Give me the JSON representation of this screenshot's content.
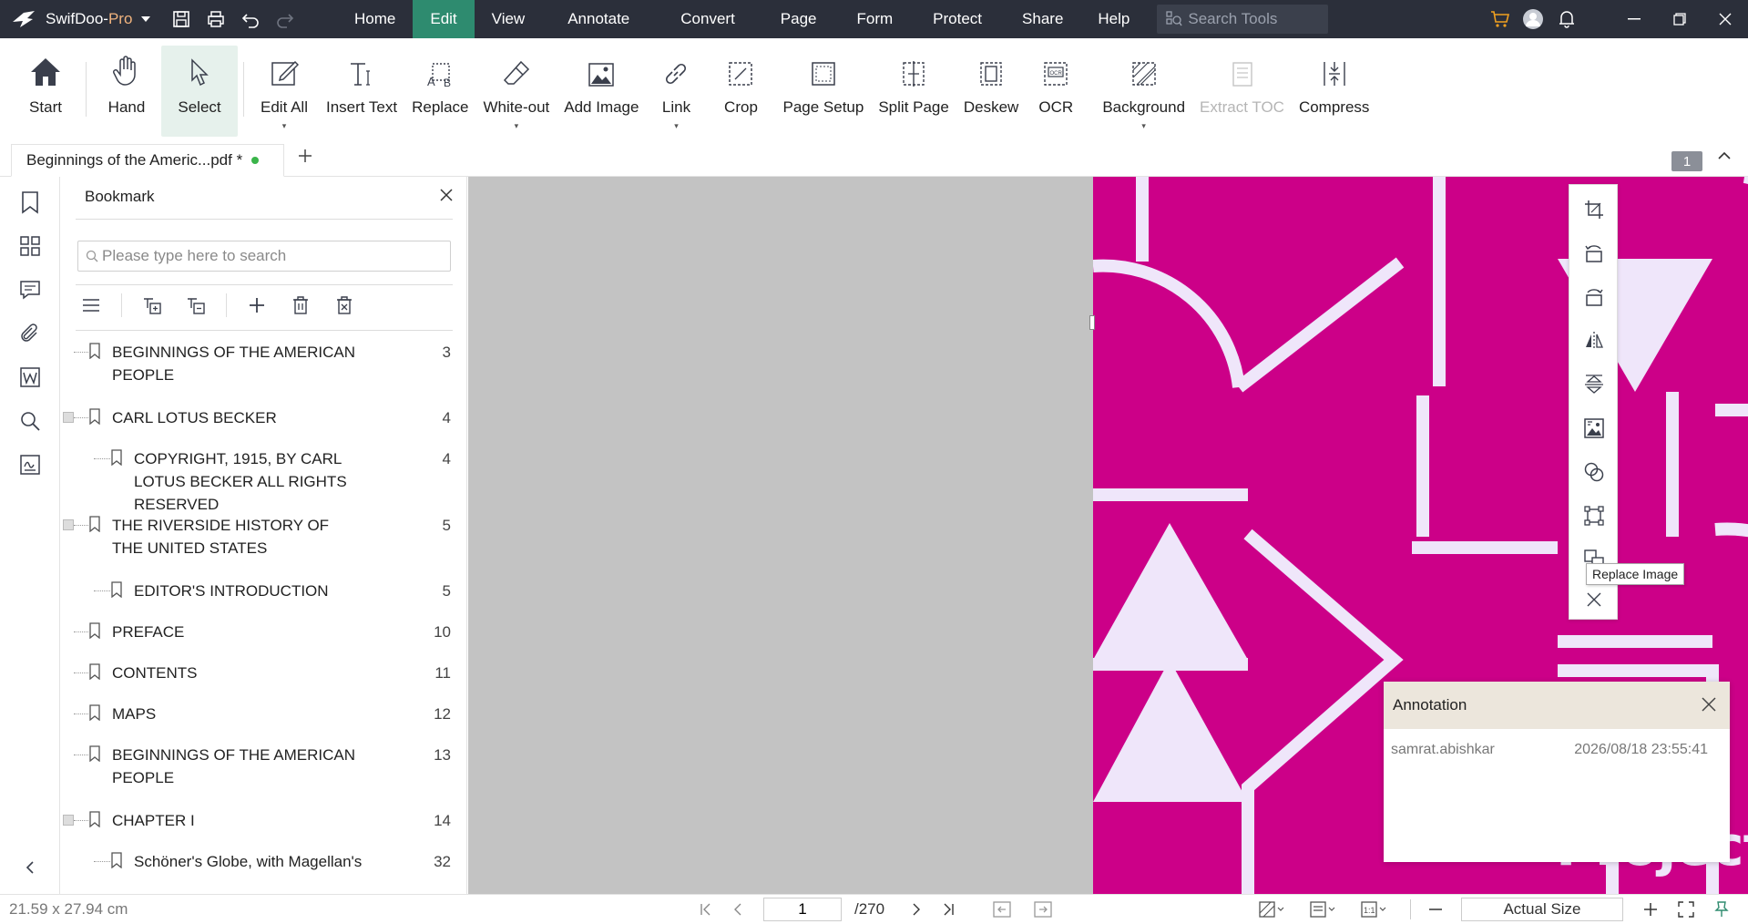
{
  "app": {
    "name_part1": "SwifDoo-",
    "name_part2": "Pro"
  },
  "menu": [
    "Home",
    "Edit",
    "View",
    "Annotate",
    "Convert",
    "Page",
    "Form",
    "Protect",
    "Share",
    "Help"
  ],
  "active_menu": "Edit",
  "search_tools": {
    "placeholder": "Search Tools"
  },
  "ribbon": {
    "start": "Start",
    "hand": "Hand",
    "select": "Select",
    "edit_all": "Edit All",
    "insert_text": "Insert Text",
    "replace": "Replace",
    "white_out": "White-out",
    "add_image": "Add Image",
    "link": "Link",
    "crop": "Crop",
    "page_setup": "Page Setup",
    "split_page": "Split Page",
    "deskew": "Deskew",
    "ocr": "OCR",
    "background": "Background",
    "extract_toc": "Extract TOC",
    "compress": "Compress"
  },
  "doc_tab": {
    "title": "Beginnings of the Americ...pdf *"
  },
  "page_badge": "1",
  "bookmark_panel": {
    "title": "Bookmark",
    "search_placeholder": "Please type here to search",
    "items": [
      {
        "title": "BEGINNINGS OF THE AMERICAN PEOPLE",
        "page": "3"
      },
      {
        "title": "CARL LOTUS BECKER",
        "page": "4"
      },
      {
        "title": "COPYRIGHT, 1915, BY CARL LOTUS BECKER ALL RIGHTS RESERVED",
        "page": "4"
      },
      {
        "title": "THE RIVERSIDE HISTORY OF THE UNITED STATES",
        "page": "5"
      },
      {
        "title": "EDITOR'S INTRODUCTION",
        "page": "5"
      },
      {
        "title": "PREFACE",
        "page": "10"
      },
      {
        "title": "CONTENTS",
        "page": "11"
      },
      {
        "title": "MAPS",
        "page": "12"
      },
      {
        "title": "BEGINNINGS OF THE AMERICAN PEOPLE",
        "page": "13"
      },
      {
        "title": "CHAPTER I",
        "page": "14"
      },
      {
        "title": "Schöner's Globe, with Magellan's",
        "page": "32"
      }
    ]
  },
  "page_content": {
    "cover_text": "Project Gutenberg"
  },
  "image_toolbar": {
    "tooltip": "Replace Image"
  },
  "annotation": {
    "title": "Annotation",
    "author": "samrat.abishkar",
    "timestamp": "2026/08/18 23:55:41"
  },
  "status": {
    "page_size": "21.59 x 27.94 cm",
    "current_page": "1",
    "total_pages": "/270",
    "zoom": "Actual Size"
  },
  "colors": {
    "titlebar": "#2b2f3a",
    "active_menu": "#2e8b6f",
    "page_magenta": "#cc0088",
    "pattern_light": "#efe6fa"
  }
}
